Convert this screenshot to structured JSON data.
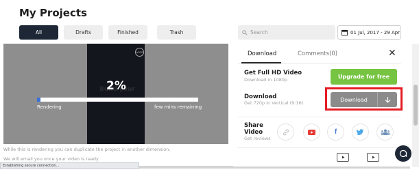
{
  "page": {
    "title": "My Projects"
  },
  "tabs": [
    {
      "label": "All",
      "active": true
    },
    {
      "label": "Drafts",
      "active": false
    },
    {
      "label": "Finished",
      "active": false
    },
    {
      "label": "Trash",
      "active": false
    }
  ],
  "search": {
    "placeholder": "Search",
    "icon": "search-icon"
  },
  "date_filter": {
    "value": "01 Jul, 2017 - 29 Apr",
    "icon": "calendar-icon"
  },
  "preview": {
    "progress_text": "2%",
    "progress_value": 0.02,
    "background_text": "Build your",
    "left_label": "Rendering",
    "right_label": "few mins remaining",
    "logo_text": "LOGO"
  },
  "notes": {
    "line1": "While this is rendering you can duplicate the project in another dimension.",
    "line2": "We will email you once your video is ready."
  },
  "status_bar": {
    "text": "Establishing secure connection..."
  },
  "panel": {
    "tabs": [
      {
        "label": "Download",
        "active": true
      },
      {
        "label": "Comments(0)",
        "active": false
      }
    ],
    "full_hd": {
      "title": "Get Full HD Video",
      "subtitle": "Download in 1080p",
      "button": "Upgrade for free"
    },
    "download": {
      "title": "Download",
      "subtitle": "Get 720p in Vertical (9:16)",
      "button": "Download"
    },
    "share": {
      "title": "Share Video",
      "subtitle": "Get reviews",
      "icons": [
        "link-icon",
        "youtube-icon",
        "facebook-icon",
        "twitter-icon",
        "team-icon"
      ]
    }
  },
  "colors": {
    "accent_dark": "#1d2735",
    "upgrade_green": "#76c442",
    "highlight_red": "#e51b23",
    "progress_blue": "#3b6fd8",
    "youtube_red": "#e53935",
    "facebook_blue": "#4a7bd6",
    "twitter_blue": "#4fa9e8",
    "team_blue": "#6e8fb8"
  }
}
